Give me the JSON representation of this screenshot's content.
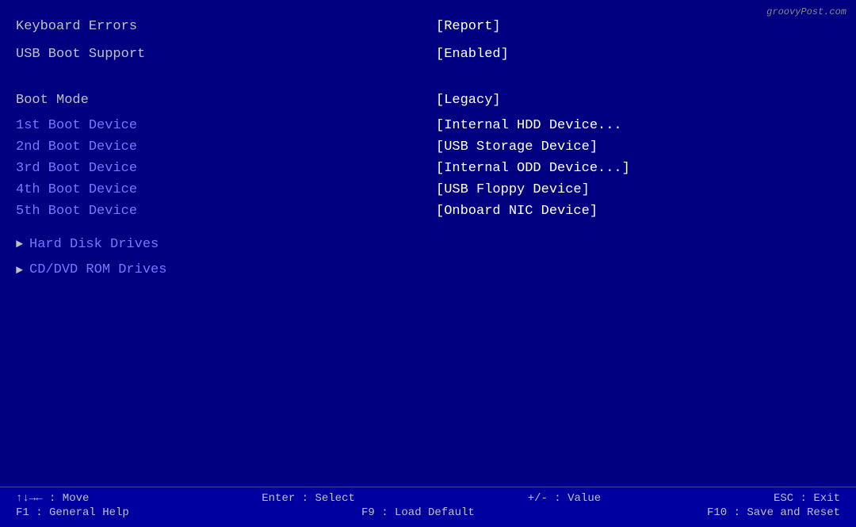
{
  "watermark": "groovyPost.com",
  "rows_top": [
    {
      "label": "Keyboard Errors",
      "value": "[Report]",
      "label_highlighted": false
    },
    {
      "label": "USB Boot Support",
      "value": "[Enabled]",
      "label_highlighted": false
    }
  ],
  "section_gap": true,
  "boot_mode": {
    "label": "Boot Mode",
    "value": "[Legacy]"
  },
  "boot_devices": [
    {
      "label": "1st Boot Device",
      "value": "[Internal HDD Device..."
    },
    {
      "label": "2nd Boot Device",
      "value": "[USB Storage Device]"
    },
    {
      "label": "3rd Boot Device",
      "value": "[Internal ODD Device...]"
    },
    {
      "label": "4th Boot Device",
      "value": "[USB Floppy Device]"
    },
    {
      "label": "5th Boot Device",
      "value": "[Onboard NIC Device]"
    }
  ],
  "drive_items": [
    "Hard Disk Drives",
    "CD/DVD ROM Drives"
  ],
  "status_bar": {
    "row1": [
      {
        "key": "↑↓→← : Move",
        "desc": ""
      },
      {
        "key": "Enter : Select",
        "desc": ""
      },
      {
        "key": "+/- : Value",
        "desc": ""
      },
      {
        "key": "ESC : Exit",
        "desc": ""
      }
    ],
    "row2": [
      {
        "key": "F1 : General Help",
        "desc": ""
      },
      {
        "key": "F9 : Load Default",
        "desc": ""
      },
      {
        "key": "F10 : Save and Reset",
        "desc": ""
      }
    ],
    "keys_row1": "↑↓→←  :  Move",
    "keys_row1_b": "Enter  :  Select",
    "keys_row1_c": "+/-  :  Value",
    "keys_row1_d": "ESC  :  Exit",
    "keys_row2_a": "F1  :  General Help",
    "keys_row2_b": "F9  :  Load Default",
    "keys_row2_c": "F10  :  Save and Reset"
  }
}
